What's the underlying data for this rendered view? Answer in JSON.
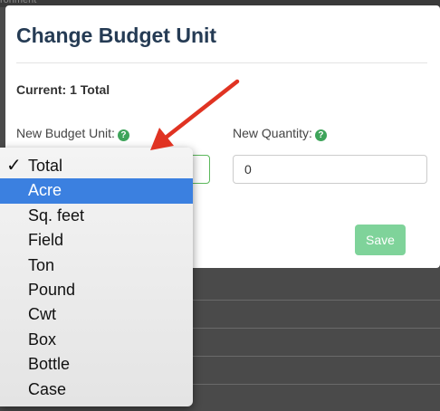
{
  "background": {
    "top_text": "ronment"
  },
  "modal": {
    "title": "Change Budget Unit",
    "current": "Current: 1 Total",
    "unit_label": "New Budget Unit:",
    "quantity_label": "New Quantity:",
    "quantity_value": "0",
    "save_label": "Save"
  },
  "dropdown": {
    "checked": "Total",
    "highlighted": "Acre",
    "check_glyph": "✓",
    "options": [
      "Total",
      "Acre",
      "Sq. feet",
      "Field",
      "Ton",
      "Pound",
      "Cwt",
      "Box",
      "Bottle",
      "Case"
    ]
  },
  "colors": {
    "accent_green": "#5cb85c",
    "title_navy": "#253b54",
    "highlight_blue": "#3b80e0",
    "arrow_red": "#e03322"
  }
}
